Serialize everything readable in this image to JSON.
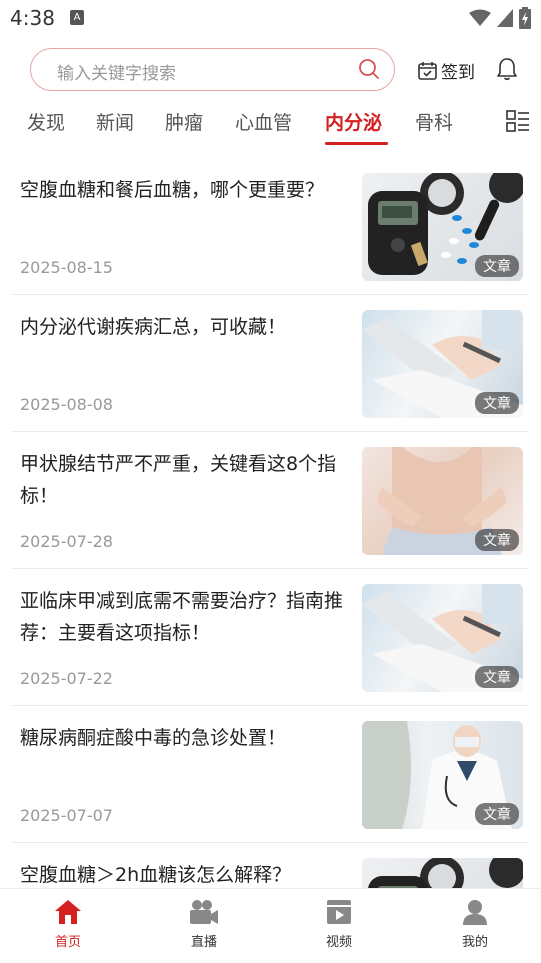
{
  "status": {
    "time": "4:38",
    "indicator": "A"
  },
  "search": {
    "placeholder": "输入关键字搜索"
  },
  "header": {
    "checkin_label": "签到"
  },
  "tabs": [
    {
      "label": "发现"
    },
    {
      "label": "新闻"
    },
    {
      "label": "肿瘤"
    },
    {
      "label": "心血管"
    },
    {
      "label": "内分泌",
      "active": true
    },
    {
      "label": "骨科"
    }
  ],
  "articles": [
    {
      "title": "空腹血糖和餐后血糖，哪个更重要？",
      "date": "2025-08-15",
      "badge": "文章",
      "image": "glucose-meter"
    },
    {
      "title": "内分泌代谢疾病汇总，可收藏！",
      "date": "2025-08-08",
      "badge": "文章",
      "image": "laptop-writing"
    },
    {
      "title": "甲状腺结节严不严重，关键看这8个指标！",
      "date": "2025-07-28",
      "badge": "文章",
      "image": "neck-exam"
    },
    {
      "title": "亚临床甲减到底需不需要治疗？指南推荐：主要看这项指标！",
      "date": "2025-07-22",
      "badge": "文章",
      "image": "laptop-writing"
    },
    {
      "title": "糖尿病酮症酸中毒的急诊处置！",
      "date": "2025-07-07",
      "badge": "文章",
      "image": "doctor"
    },
    {
      "title": "空腹血糖＞2h血糖该怎么解释？",
      "date": "",
      "badge": "",
      "image": "glucose-meter"
    }
  ],
  "bottom_nav": [
    {
      "label": "首页",
      "icon": "home-icon",
      "active": true
    },
    {
      "label": "直播",
      "icon": "video-camera-icon"
    },
    {
      "label": "视频",
      "icon": "play-video-icon"
    },
    {
      "label": "我的",
      "icon": "profile-icon"
    }
  ],
  "colors": {
    "accent": "#d42020",
    "search_border": "#e9a5a5"
  }
}
